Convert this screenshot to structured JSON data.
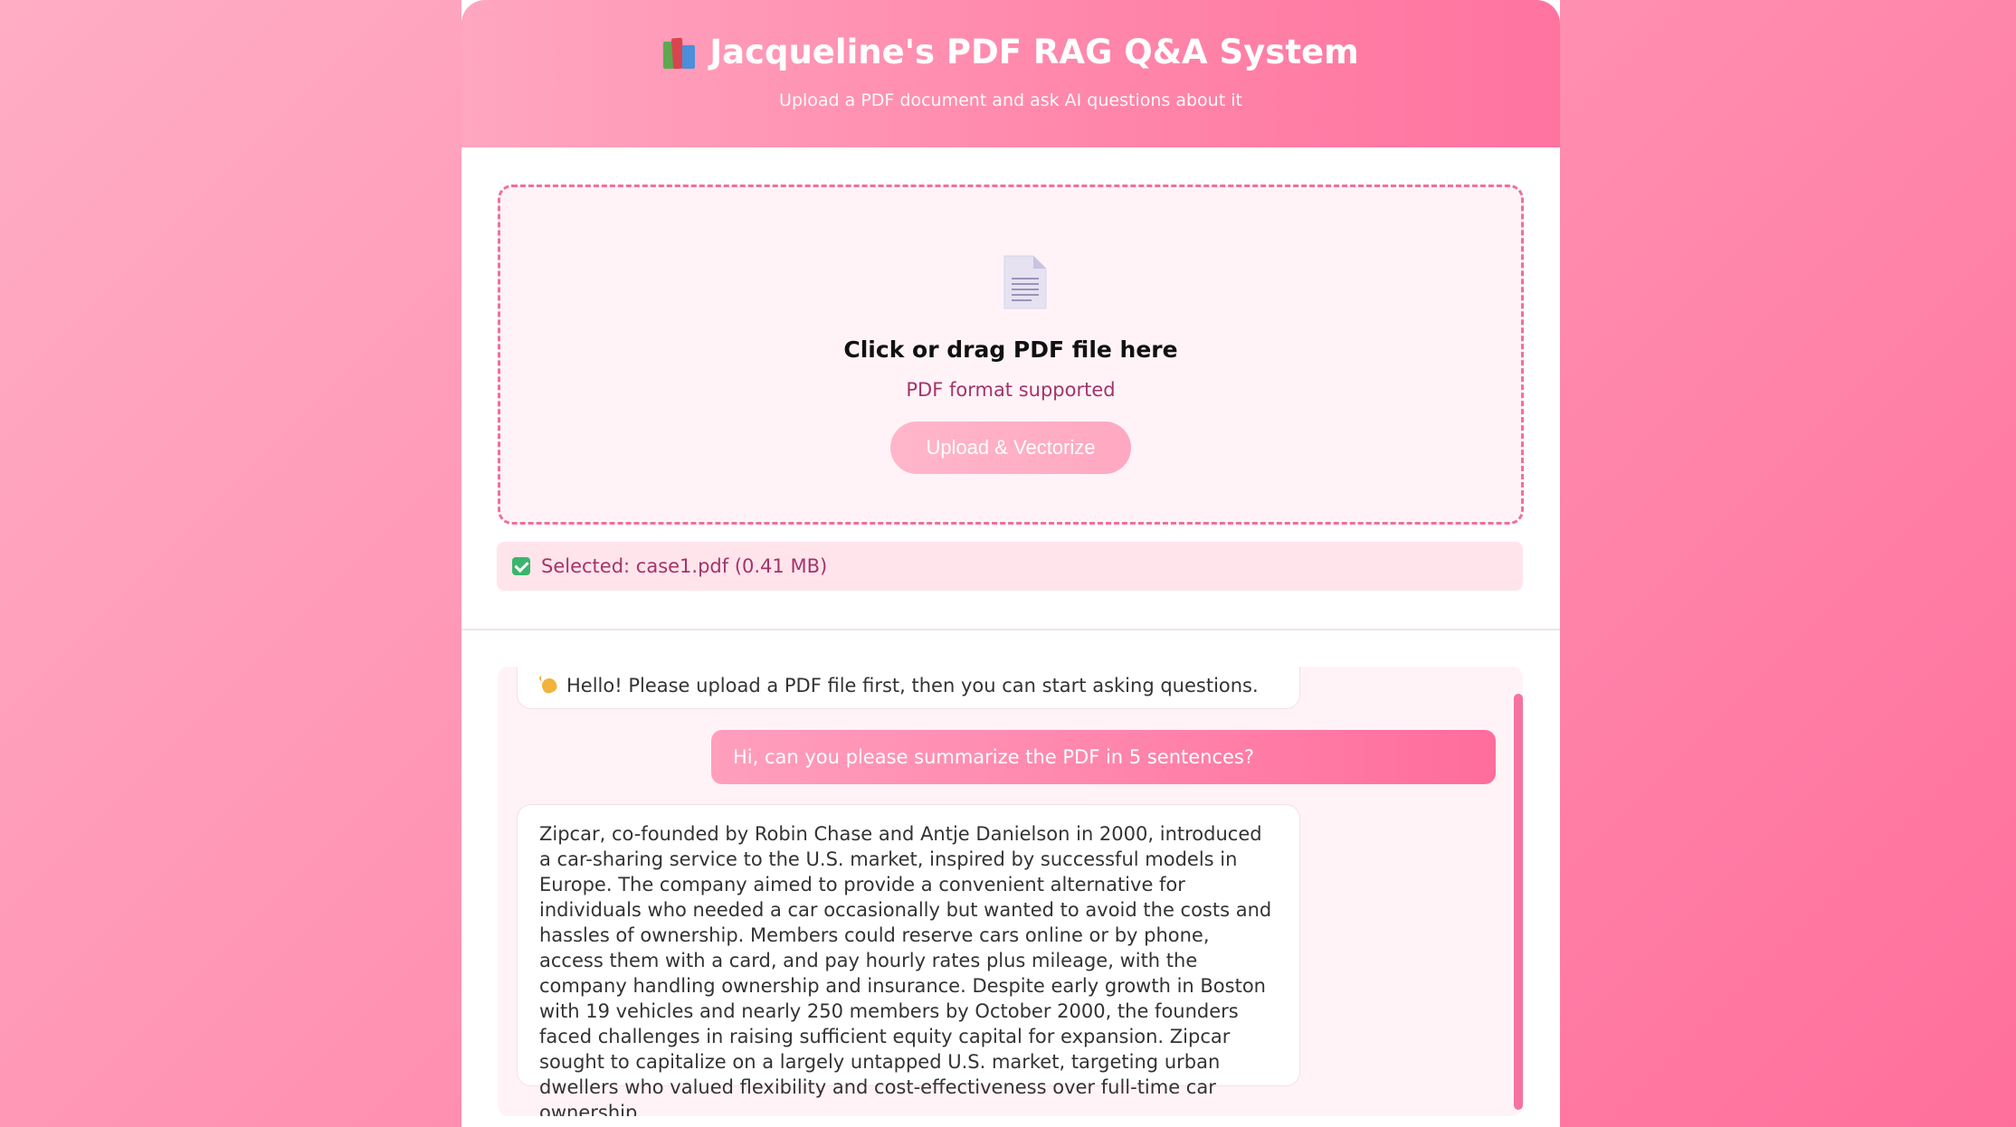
{
  "header": {
    "title": "Jacqueline's PDF RAG Q&A System",
    "subtitle": "Upload a PDF document and ask AI questions about it",
    "title_icon": "books-icon"
  },
  "upload": {
    "icon": "document-icon",
    "title": "Click or drag PDF file here",
    "hint": "PDF format supported",
    "button_label": "Upload & Vectorize"
  },
  "selected_file": {
    "icon": "check-icon",
    "text": "Selected: case1.pdf (0.41 MB)"
  },
  "chat": {
    "messages": [
      {
        "role": "bot",
        "icon": "wave-icon",
        "text": "Hello! Please upload a PDF file first, then you can start asking questions."
      },
      {
        "role": "user",
        "text": "Hi, can you please summarize the PDF in 5 sentences?"
      },
      {
        "role": "bot",
        "text": "Zipcar, co-founded by Robin Chase and Antje Danielson in 2000, introduced a car-sharing service to the U.S. market, inspired by successful models in Europe. The company aimed to provide a convenient alternative for individuals who needed a car occasionally but wanted to avoid the costs and hassles of ownership. Members could reserve cars online or by phone, access them with a card, and pay hourly rates plus mileage, with the company handling ownership and insurance. Despite early growth in Boston with 19 vehicles and nearly 250 members by October 2000, the founders faced challenges in raising sufficient equity capital for expansion. Zipcar sought to capitalize on a largely untapped U.S. market, targeting urban dwellers who valued flexibility and cost-effectiveness over full-time car ownership."
      }
    ]
  },
  "colors": {
    "accent": "#ff6f9c",
    "upload_border": "#f0709c",
    "hint_text": "#a4336a",
    "success": "#3bb56d"
  }
}
